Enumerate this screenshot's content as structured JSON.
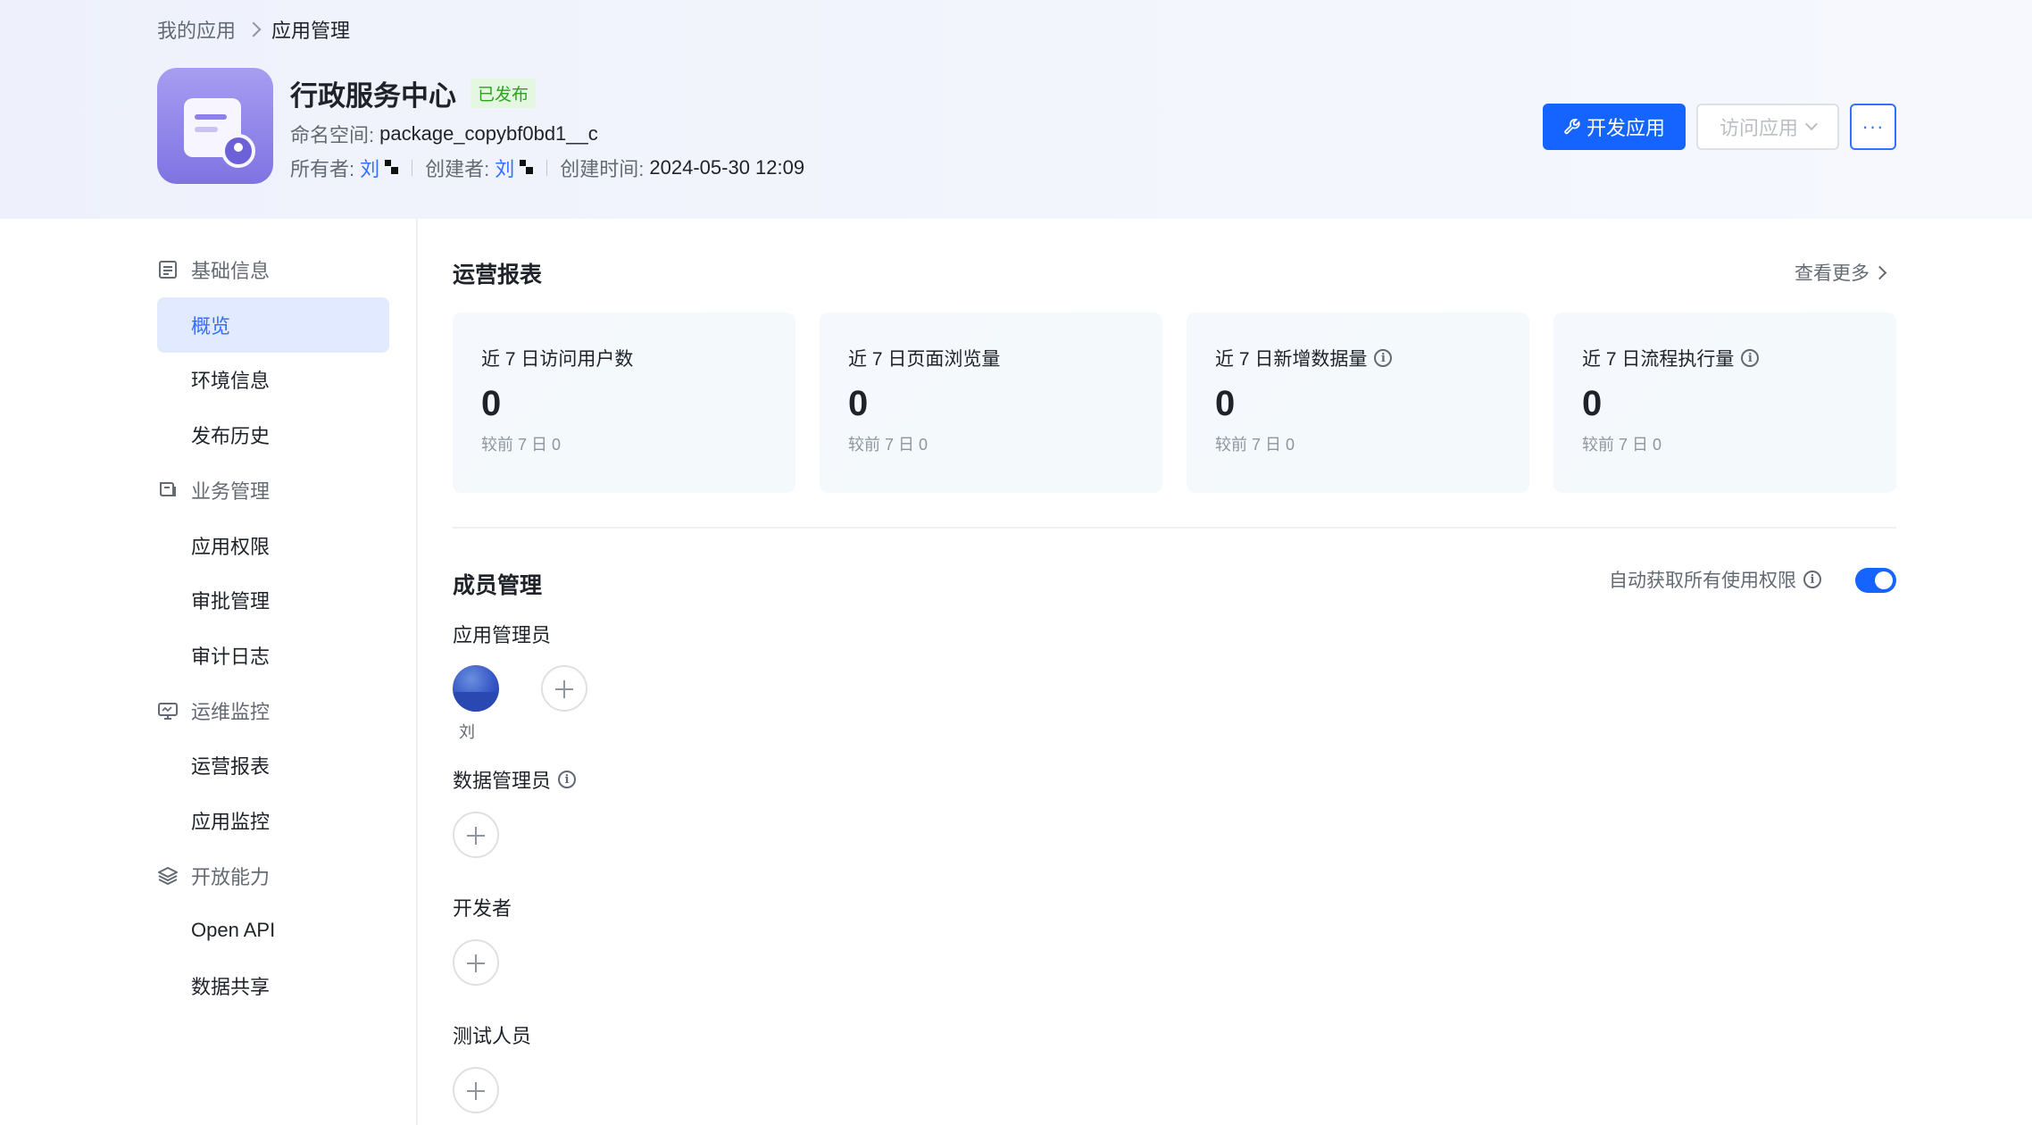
{
  "breadcrumb": {
    "root": "我的应用",
    "current": "应用管理"
  },
  "app": {
    "title": "行政服务中心",
    "status": "已发布",
    "namespace_label": "命名空间:",
    "namespace_value": "package_copybf0bd1__c",
    "owner_label": "所有者:",
    "owner_name": "刘",
    "creator_label": "创建者:",
    "creator_name": "刘",
    "created_label": "创建时间:",
    "created_value": "2024-05-30 12:09"
  },
  "actions": {
    "develop": "开发应用",
    "visit": "访问应用",
    "more": "···"
  },
  "sidebar": {
    "groups": [
      {
        "label": "基础信息",
        "icon": "doc-list-icon",
        "items": [
          "概览",
          "环境信息",
          "发布历史"
        ]
      },
      {
        "label": "业务管理",
        "icon": "book-icon",
        "items": [
          "应用权限",
          "审批管理",
          "审计日志"
        ]
      },
      {
        "label": "运维监控",
        "icon": "monitor-icon",
        "items": [
          "运营报表",
          "应用监控"
        ]
      },
      {
        "label": "开放能力",
        "icon": "layers-icon",
        "items": [
          "Open API",
          "数据共享"
        ]
      }
    ],
    "active": "概览"
  },
  "report": {
    "title": "运营报表",
    "more": "查看更多",
    "cards": [
      {
        "label": "近 7 日访问用户数",
        "value": "0",
        "compare": "较前 7 日  0",
        "info": false
      },
      {
        "label": "近 7 日页面浏览量",
        "value": "0",
        "compare": "较前 7 日  0",
        "info": false
      },
      {
        "label": "近 7 日新增数据量",
        "value": "0",
        "compare": "较前 7 日  0",
        "info": true
      },
      {
        "label": "近 7 日流程执行量",
        "value": "0",
        "compare": "较前 7 日  0",
        "info": true
      }
    ]
  },
  "members": {
    "title": "成员管理",
    "auto_permission": "自动获取所有使用权限",
    "auto_permission_on": true,
    "roles": {
      "admin": {
        "label": "应用管理员",
        "member": "刘"
      },
      "data_admin": {
        "label": "数据管理员"
      },
      "developer": {
        "label": "开发者"
      },
      "tester": {
        "label": "测试人员"
      }
    }
  },
  "colors": {
    "primary": "#1664ff",
    "link": "#3370ff",
    "success": "#2ea121",
    "active_bg": "#e1eaff"
  }
}
